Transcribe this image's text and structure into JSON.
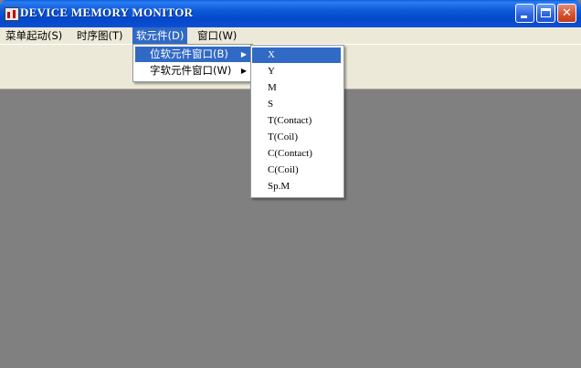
{
  "window": {
    "title": "DEVICE MEMORY MONITOR",
    "buttons": {
      "minimize": "_",
      "maximize": "□",
      "close": "✕"
    }
  },
  "menubar": {
    "items": [
      {
        "label": "菜单起动(S)"
      },
      {
        "label": "时序图(T)"
      },
      {
        "label": "软元件(D)"
      },
      {
        "label": "窗口(W)"
      }
    ]
  },
  "device_menu": {
    "items": [
      {
        "label": "位软元件窗口(B)",
        "arrow": "▶"
      },
      {
        "label": "字软元件窗口(W)",
        "arrow": "▶"
      }
    ]
  },
  "bit_device_submenu": {
    "items": [
      "X",
      "Y",
      "M",
      "S",
      "T(Contact)",
      "T(Coil)",
      "C(Contact)",
      "C(Coil)",
      "Sp.M"
    ]
  }
}
